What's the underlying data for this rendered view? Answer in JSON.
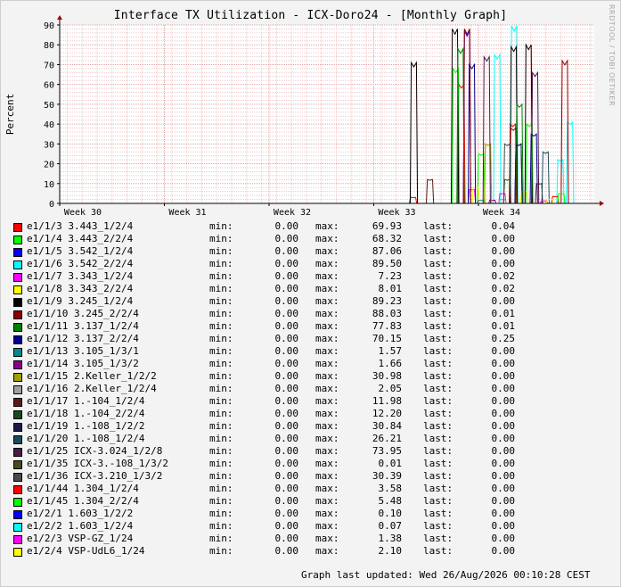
{
  "chart_data": {
    "type": "line",
    "title": "Interface TX Utilization - ICX-Doro24 - [Monthly Graph]",
    "ylabel": "Percent",
    "xlabel": "",
    "ylim": [
      0,
      90
    ],
    "yticks": [
      "0",
      "10",
      "20",
      "30",
      "40",
      "50",
      "60",
      "70",
      "80",
      "90"
    ],
    "xticks": [
      "Week 30",
      "Week 31",
      "Week 32",
      "Week 33",
      "Week 34"
    ],
    "grid": true,
    "watermark": "RRDTOOL / TOBI OETIKER",
    "series": [
      {
        "name": "e1/1/3 3.443_1/2/4",
        "color": "#ff0000",
        "min": "0.00",
        "max": "69.93",
        "last": "0.04",
        "bursts": [
          [
            33.35,
            3
          ],
          [
            33.8,
            60
          ],
          [
            34.3,
            40
          ]
        ]
      },
      {
        "name": "e1/1/4 3.443_2/2/4",
        "color": "#00ff00",
        "min": "0.00",
        "max": "68.32",
        "last": "0.00",
        "bursts": [
          [
            33.75,
            68
          ],
          [
            34.0,
            25
          ],
          [
            34.45,
            40
          ]
        ]
      },
      {
        "name": "e1/1/5 3.542_1/2/4",
        "color": "#0000ff",
        "min": "0.00",
        "max": "87.06",
        "last": "0.00",
        "bursts": [
          [
            33.85,
            87
          ],
          [
            34.35,
            30
          ]
        ]
      },
      {
        "name": "e1/1/6 3.542_2/2/4",
        "color": "#00ffff",
        "min": "0.00",
        "max": "89.50",
        "last": "0.00",
        "bursts": [
          [
            34.15,
            75
          ],
          [
            34.3,
            89.5
          ],
          [
            34.75,
            22
          ],
          [
            34.85,
            41
          ]
        ]
      },
      {
        "name": "e1/1/7 3.343_1/2/4",
        "color": "#ff00ff",
        "min": "0.00",
        "max": "7.23",
        "last": "0.02",
        "bursts": [
          [
            33.9,
            7
          ],
          [
            34.2,
            5
          ]
        ]
      },
      {
        "name": "e1/1/8 3.343_2/2/4",
        "color": "#ffff00",
        "min": "0.00",
        "max": "8.01",
        "last": "0.02",
        "bursts": [
          [
            33.95,
            8
          ],
          [
            34.4,
            6
          ]
        ]
      },
      {
        "name": "e1/1/9 3.245_1/2/4",
        "color": "#000000",
        "min": "0.00",
        "max": "89.23",
        "last": "0.00",
        "bursts": [
          [
            33.35,
            71
          ],
          [
            33.75,
            88
          ],
          [
            34.3,
            79
          ],
          [
            34.45,
            80
          ]
        ]
      },
      {
        "name": "e1/1/10 3.245_2/2/4",
        "color": "#8b0000",
        "min": "0.00",
        "max": "88.03",
        "last": "0.01",
        "bursts": [
          [
            33.85,
            88
          ],
          [
            34.3,
            38
          ],
          [
            34.8,
            72
          ]
        ]
      },
      {
        "name": "e1/1/11 3.137_1/2/4",
        "color": "#008000",
        "min": "0.00",
        "max": "77.83",
        "last": "0.01",
        "bursts": [
          [
            33.8,
            78
          ],
          [
            34.35,
            50
          ]
        ]
      },
      {
        "name": "e1/1/12 3.137_2/2/4",
        "color": "#00008b",
        "min": "0.00",
        "max": "70.15",
        "last": "0.25",
        "bursts": [
          [
            33.9,
            70
          ],
          [
            34.5,
            35
          ]
        ]
      },
      {
        "name": "e1/1/13 3.105_1/3/1",
        "color": "#008b8b",
        "min": "0.00",
        "max": "1.57",
        "last": "0.00",
        "bursts": [
          [
            34.0,
            1.5
          ]
        ]
      },
      {
        "name": "e1/1/14 3.105_1/3/2",
        "color": "#8b008b",
        "min": "0.00",
        "max": "1.66",
        "last": "0.00",
        "bursts": [
          [
            34.1,
            1.6
          ]
        ]
      },
      {
        "name": "e1/1/15 2.Keller_1/2/2",
        "color": "#a0a000",
        "min": "0.00",
        "max": "30.98",
        "last": "0.00",
        "bursts": [
          [
            34.05,
            30
          ]
        ]
      },
      {
        "name": "e1/1/16 2.Keller_1/2/4",
        "color": "#a0a0a0",
        "min": "0.00",
        "max": "2.05",
        "last": "0.00",
        "bursts": [
          [
            34.2,
            2
          ]
        ]
      },
      {
        "name": "e1/1/17 1.-104_1/2/4",
        "color": "#5a1a1a",
        "min": "0.00",
        "max": "11.98",
        "last": "0.00",
        "bursts": [
          [
            33.5,
            12
          ],
          [
            34.55,
            10
          ]
        ]
      },
      {
        "name": "e1/1/18 1.-104_2/2/4",
        "color": "#1a4a1a",
        "min": "0.00",
        "max": "12.20",
        "last": "0.00",
        "bursts": [
          [
            34.25,
            12
          ]
        ]
      },
      {
        "name": "e1/1/19 1.-108_1/2/2",
        "color": "#1a1a4a",
        "min": "0.00",
        "max": "30.84",
        "last": "0.00",
        "bursts": [
          [
            34.35,
            30
          ]
        ]
      },
      {
        "name": "e1/1/20 1.-108_1/2/4",
        "color": "#1a4a5a",
        "min": "0.00",
        "max": "26.21",
        "last": "0.00",
        "bursts": [
          [
            34.6,
            26
          ]
        ]
      },
      {
        "name": "e1/1/25 ICX-3.024_1/2/8",
        "color": "#4a1a4a",
        "min": "0.00",
        "max": "73.95",
        "last": "0.00",
        "bursts": [
          [
            34.05,
            74
          ],
          [
            34.5,
            66
          ]
        ]
      },
      {
        "name": "e1/1/35 ICX-3.-108_1/3/2",
        "color": "#4a4a1a",
        "min": "0.00",
        "max": "0.01",
        "last": "0.00",
        "bursts": []
      },
      {
        "name": "e1/1/36 ICX-3.210_1/3/2",
        "color": "#4a4a4a",
        "min": "0.00",
        "max": "30.39",
        "last": "0.00",
        "bursts": [
          [
            34.25,
            30
          ]
        ]
      },
      {
        "name": "e1/1/44 1.304_1/2/4",
        "color": "#ff0000",
        "min": "0.00",
        "max": "3.58",
        "last": "0.00",
        "bursts": [
          [
            34.7,
            3.5
          ]
        ]
      },
      {
        "name": "e1/1/45 1.304_2/2/4",
        "color": "#00ff00",
        "min": "0.00",
        "max": "5.48",
        "last": "0.00",
        "bursts": [
          [
            34.75,
            5
          ]
        ]
      },
      {
        "name": "e1/2/1 1.603_1/2/2",
        "color": "#0000ff",
        "min": "0.00",
        "max": "0.10",
        "last": "0.00",
        "bursts": []
      },
      {
        "name": "e1/2/2 1.603_1/2/4",
        "color": "#00ffff",
        "min": "0.00",
        "max": "0.07",
        "last": "0.00",
        "bursts": []
      },
      {
        "name": "e1/2/3 VSP-GZ_1/24",
        "color": "#ff00ff",
        "min": "0.00",
        "max": "1.38",
        "last": "0.00",
        "bursts": [
          [
            34.6,
            1.3
          ]
        ]
      },
      {
        "name": "e1/2/4 VSP-UdL6_1/24",
        "color": "#ffff00",
        "min": "0.00",
        "max": "2.10",
        "last": "0.00",
        "bursts": [
          [
            34.65,
            2
          ]
        ]
      }
    ]
  },
  "legend_labels": {
    "min": "min:",
    "max": "max:",
    "last": "last:"
  },
  "footer": {
    "updated": "Graph last updated: Wed 26/Aug/2026 00:10:28 CEST"
  }
}
